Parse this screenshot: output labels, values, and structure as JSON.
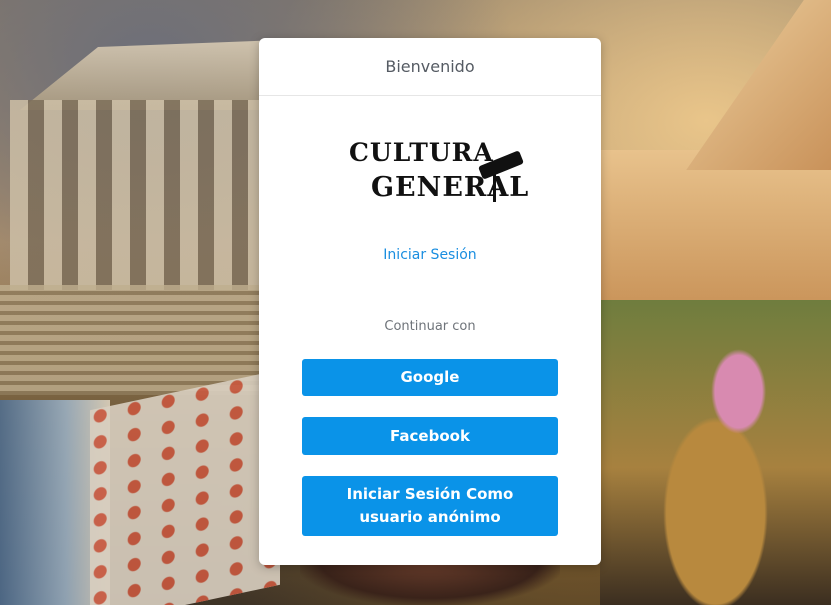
{
  "card": {
    "header_title": "Bienvenido",
    "logo": {
      "line1": "CULTURA",
      "line2": "GENERAL",
      "icon": "telescope-icon"
    },
    "login_link": "Iniciar Sesión",
    "continue_label": "Continuar con",
    "buttons": {
      "google": "Google",
      "facebook": "Facebook",
      "anonymous": "Iniciar Sesión Como usuario anónimo"
    }
  },
  "colors": {
    "accent": "#0a93e8",
    "link": "#1a8ee0",
    "card_bg": "#ffffff"
  }
}
